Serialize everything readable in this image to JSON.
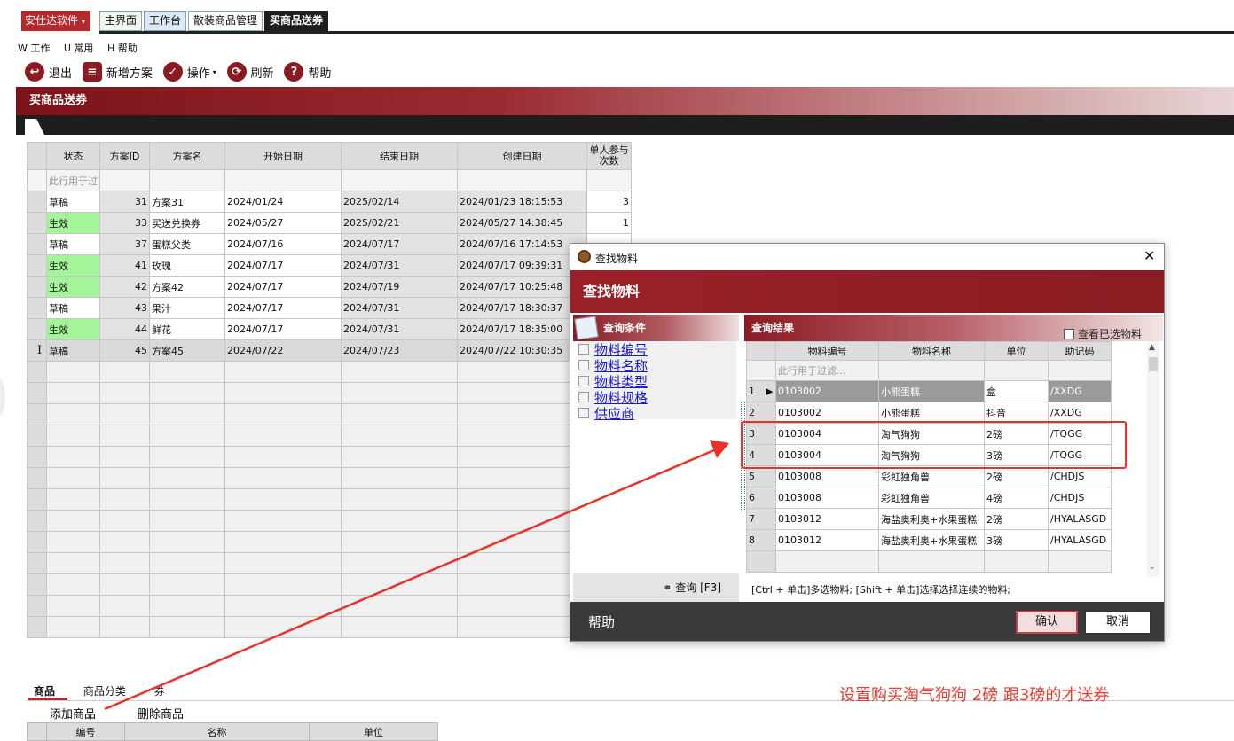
{
  "app": {
    "brand": "安仕达软件",
    "tabs": [
      "主界面",
      "工作台",
      "散装商品管理",
      "买商品送券"
    ],
    "menu": [
      "W 工作",
      "U 常用",
      "H 帮助"
    ],
    "toolbar": [
      "退出",
      "新增方案",
      "操作",
      "刷新",
      "帮助"
    ],
    "page_title": "买商品送券"
  },
  "grid": {
    "headers": [
      "状态",
      "方案ID",
      "方案名",
      "开始日期",
      "结束日期",
      "创建日期",
      "单人参与次数"
    ],
    "filter_hint": "此行用于过",
    "rows": [
      {
        "status": "草稿",
        "id": "31",
        "name": "方案31",
        "start": "2024/01/24",
        "end": "2025/02/14",
        "created": "2024/01/23 18:15:53",
        "times": "3",
        "green": false
      },
      {
        "status": "生效",
        "id": "33",
        "name": "买送兑换券",
        "start": "2024/05/27",
        "end": "2025/02/21",
        "created": "2024/05/27 14:38:45",
        "times": "1",
        "green": true
      },
      {
        "status": "草稿",
        "id": "37",
        "name": "蛋糕父类",
        "start": "2024/07/16",
        "end": "2024/07/17",
        "created": "2024/07/16 17:14:53",
        "times": "",
        "green": false
      },
      {
        "status": "生效",
        "id": "41",
        "name": "玫瑰",
        "start": "2024/07/17",
        "end": "2024/07/31",
        "created": "2024/07/17 09:39:31",
        "times": "",
        "green": true
      },
      {
        "status": "生效",
        "id": "42",
        "name": "方案42",
        "start": "2024/07/17",
        "end": "2024/07/19",
        "created": "2024/07/17 10:25:48",
        "times": "",
        "green": true
      },
      {
        "status": "草稿",
        "id": "43",
        "name": "果汁",
        "start": "2024/07/17",
        "end": "2024/07/31",
        "created": "2024/07/17 18:30:37",
        "times": "",
        "green": false
      },
      {
        "status": "生效",
        "id": "44",
        "name": "鲜花",
        "start": "2024/07/17",
        "end": "2024/07/31",
        "created": "2024/07/17 18:35:00",
        "times": "",
        "green": true
      },
      {
        "status": "草稿",
        "id": "45",
        "name": "方案45",
        "start": "2024/07/22",
        "end": "2024/07/23",
        "created": "2024/07/22 10:30:35",
        "times": "",
        "green": false
      }
    ]
  },
  "bottom": {
    "tabs": [
      "商品",
      "商品分类",
      "券"
    ],
    "add_label": "添加商品",
    "delete_label": "删除商品",
    "headers": [
      "编号",
      "名称",
      "单位"
    ]
  },
  "annotation": "设置购买淘气狗狗 2磅 跟3磅的才送券",
  "dialog": {
    "window_title": "查找物料",
    "banner": "查找物料",
    "conditions_title": "查询条件",
    "conditions": [
      "物料编号",
      "物料名称",
      "物料类型",
      "物料规格",
      "供应商"
    ],
    "query_button": "查询 [F3]",
    "results_title": "查询结果",
    "show_selected": "查看已选物料",
    "headers": [
      "物料编号",
      "物料名称",
      "单位",
      "助记码"
    ],
    "filter_hint": "此行用于过滤...",
    "rows": [
      {
        "n": "1",
        "code": "0103002",
        "name": "小熊蛋糕",
        "unit": "盒",
        "memo": "/XXDG"
      },
      {
        "n": "2",
        "code": "0103002",
        "name": "小熊蛋糕",
        "unit": "抖音",
        "memo": "/XXDG"
      },
      {
        "n": "3",
        "code": "0103004",
        "name": "淘气狗狗",
        "unit": "2磅",
        "memo": "/TQGG"
      },
      {
        "n": "4",
        "code": "0103004",
        "name": "淘气狗狗",
        "unit": "3磅",
        "memo": "/TQGG"
      },
      {
        "n": "5",
        "code": "0103008",
        "name": "彩虹独角兽",
        "unit": "2磅",
        "memo": "/CHDJS"
      },
      {
        "n": "6",
        "code": "0103008",
        "name": "彩虹独角兽",
        "unit": "4磅",
        "memo": "/CHDJS"
      },
      {
        "n": "7",
        "code": "0103012",
        "name": "海盐奥利奥+水果蛋糕",
        "unit": "2磅",
        "memo": "/HYALASGD"
      },
      {
        "n": "8",
        "code": "0103012",
        "name": "海盐奥利奥+水果蛋糕",
        "unit": "3磅",
        "memo": "/HYALASGD"
      }
    ],
    "hint": "[Ctrl + 单击]多选物料; [Shift + 单击]选择选择连续的物料;",
    "help_label": "帮助",
    "ok_label": "确认",
    "cancel_label": "取消"
  },
  "colors": {
    "accent": "#8b1b22",
    "active_status": "#a4f59a",
    "annotation": "#ee3a2e"
  }
}
